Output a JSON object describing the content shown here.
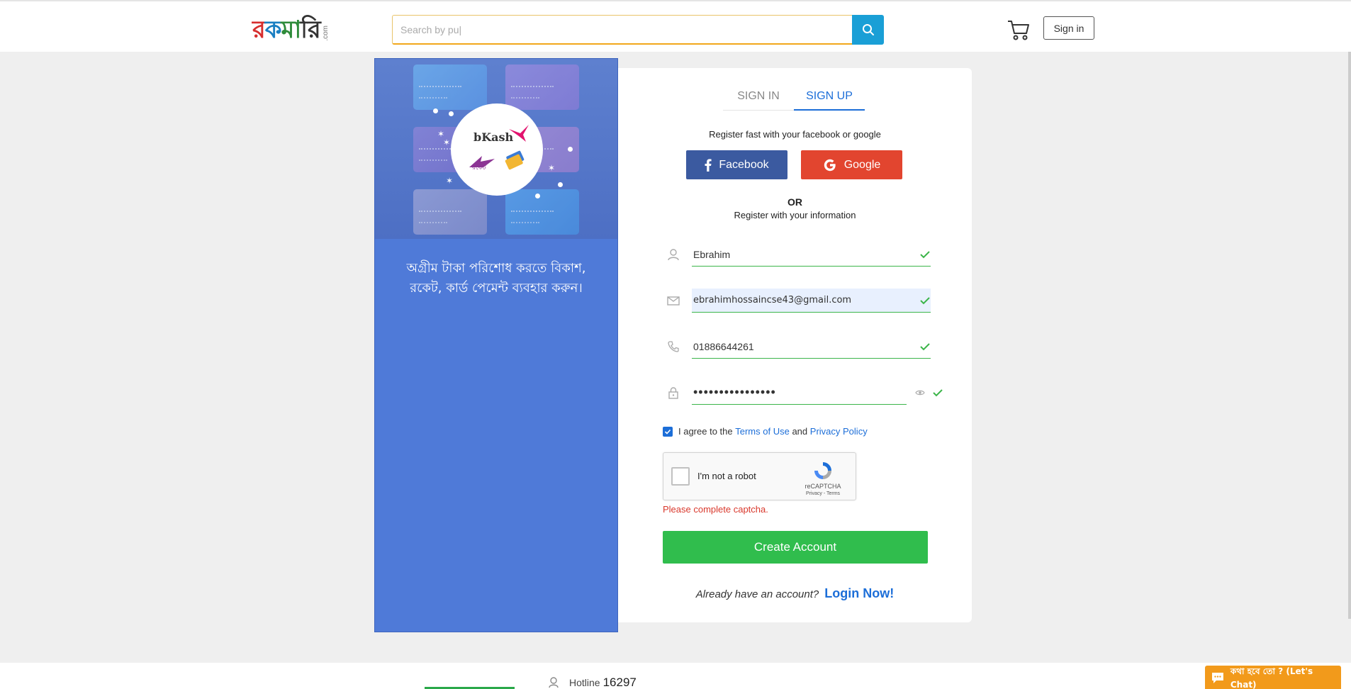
{
  "header": {
    "logo_text": "রকমারি",
    "logo_suffix": ".com",
    "search_placeholder": "Search by pu|",
    "cart_icon": "cart-icon",
    "signin_label": "Sign in"
  },
  "promo": {
    "bkash_label": "bKash",
    "text": "অগ্রীম টাকা পরিশোধ করতে বিকাশ, রকেট, কার্ড পেমেন্ট ব্যবহার করুন।"
  },
  "form": {
    "tabs": [
      {
        "label": "SIGN IN",
        "active": false
      },
      {
        "label": "SIGN UP",
        "active": true
      }
    ],
    "register_fast": "Register fast with your facebook or google",
    "facebook_label": "Facebook",
    "google_label": "Google",
    "or_label": "OR",
    "register_info": "Register with your information",
    "name_value": "Ebrahim",
    "email_value": "ebrahimhossaincse43@gmail.com",
    "phone_value": "01886644261",
    "password_value": "••••••••••••••••",
    "agree_prefix": "I agree to the",
    "terms_label": "Terms of Use",
    "agree_and": "and",
    "privacy_label": "Privacy Policy",
    "captcha_label": "I'm not a robot",
    "captcha_brand": "reCAPTCHA",
    "captcha_links": "Privacy - Terms",
    "captcha_error": "Please complete captcha.",
    "create_label": "Create Account",
    "already_text": "Already have an account?",
    "login_now": "Login Now!"
  },
  "footer": {
    "hotline_label": "Hotline",
    "hotline_number": "16297",
    "chat_label": "কথা হবে তো ? (Let's Chat)"
  },
  "colors": {
    "accent": "#1c6ed8",
    "success": "#30bd4d",
    "facebook": "#3b5aa0",
    "google": "#e2452f",
    "promo_bg": "#4f7ad8",
    "chat": "#f29a1b"
  }
}
